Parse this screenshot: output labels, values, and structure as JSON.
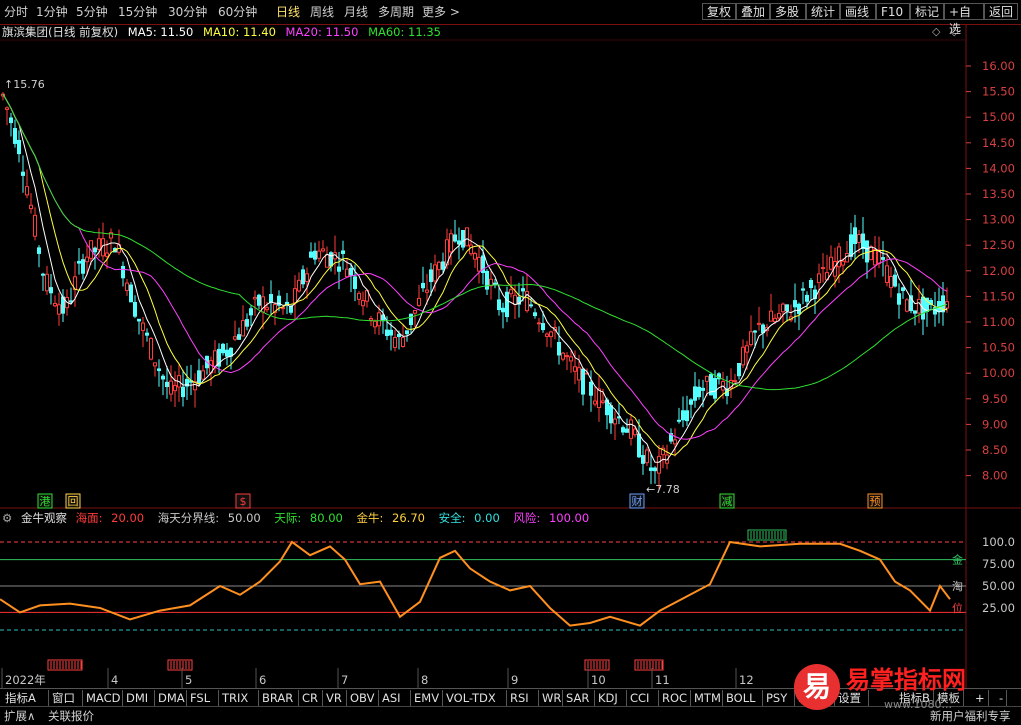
{
  "topbar": {
    "periods": [
      "分时",
      "1分钟",
      "5分钟",
      "15分钟",
      "30分钟",
      "60分钟",
      "日线",
      "周线",
      "月线",
      "多周期",
      "更多"
    ],
    "active_period": "日线",
    "right_buttons": [
      "复权",
      "叠加",
      "多股",
      "统计",
      "画线",
      "F10",
      "标记",
      "+自选",
      "返回"
    ]
  },
  "legend": {
    "stock": "旗滨集团(日线 前复权)",
    "ma5": "MA5: 11.50",
    "ma10": "MA10: 11.40",
    "ma20": "MA20: 11.50",
    "ma60": "MA60: 11.35"
  },
  "colors": {
    "up": "#ff3b3b",
    "down": "#54ffff",
    "ma5": "#ffffff",
    "ma10": "#ffff40",
    "ma20": "#ff40ff",
    "ma60": "#30e030",
    "axis": "#d84040",
    "indicator": "#ff9020"
  },
  "price_axis": [
    "16.00",
    "15.50",
    "15.00",
    "14.50",
    "14.00",
    "13.50",
    "13.00",
    "12.50",
    "12.00",
    "11.50",
    "11.00",
    "10.50",
    "10.00",
    "9.50",
    "9.00",
    "8.50",
    "8.00"
  ],
  "annotations": {
    "high": "15.76",
    "low": "7.78",
    "markers": [
      {
        "text": "港",
        "color": "#30e030"
      },
      {
        "text": "回",
        "color": "#ffd040"
      },
      {
        "text": "$",
        "color": "#ff3b3b"
      },
      {
        "text": "财",
        "color": "#6aa0ff"
      },
      {
        "text": "减",
        "color": "#30e030"
      },
      {
        "text": "预",
        "color": "#ff9020"
      }
    ]
  },
  "indicator": {
    "name": "金牛观察",
    "params": [
      {
        "label": "海面:",
        "value": "20.00",
        "color": "#ff3b3b"
      },
      {
        "label": "海天分界线:",
        "value": "50.00",
        "color": "#c8c8c8"
      },
      {
        "label": "天际:",
        "value": "80.00",
        "color": "#30e030"
      },
      {
        "label": "金牛:",
        "value": "26.70",
        "color": "#ffd040"
      },
      {
        "label": "安全:",
        "value": "0.00",
        "color": "#30e0e0"
      },
      {
        "label": "风险:",
        "value": "100.00",
        "color": "#ff40ff"
      }
    ],
    "axis": [
      "100.0",
      "75.00",
      "50.00",
      "25.00"
    ],
    "side_labels": [
      "金",
      "淘",
      "位"
    ]
  },
  "months": [
    "2022年",
    "4",
    "5",
    "6",
    "7",
    "8",
    "9",
    "10",
    "11",
    "12"
  ],
  "indicator_tabs": [
    "指标A",
    "窗口",
    "MACD",
    "DMI",
    "DMA",
    "FSL",
    "TRIX",
    "BRAR",
    "CR",
    "VR",
    "OBV",
    "ASI",
    "EMV",
    "VOL-TDX",
    "RSI",
    "WR",
    "SAR",
    "KDJ",
    "CCI",
    "ROC",
    "MTM",
    "BOLL",
    "PSY",
    "MCST",
    "设置"
  ],
  "indicator_right": [
    "指标B",
    "模板",
    "+",
    "-"
  ],
  "bottombar": {
    "left": [
      "扩展∧",
      "关联报价"
    ],
    "right": "新用户福利专享"
  },
  "watermark": {
    "logo": "易",
    "text": "易掌指标网",
    "url": "www.1080..."
  }
}
